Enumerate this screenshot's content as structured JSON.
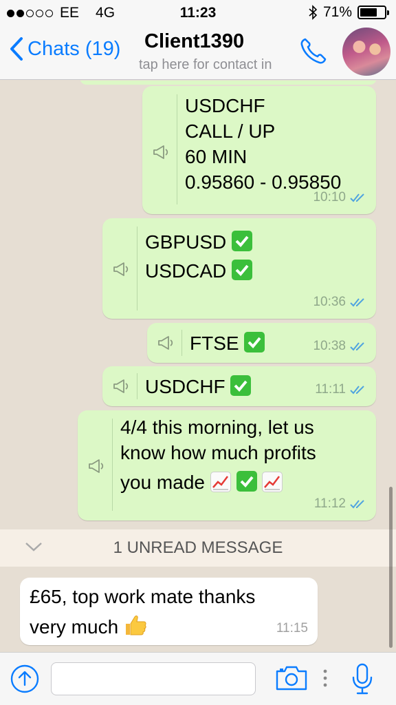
{
  "status_bar": {
    "carrier": "EE",
    "network": "4G",
    "time": "11:23",
    "battery": "71%",
    "battery_level": 0.71
  },
  "nav": {
    "back_label": "Chats (19)",
    "contact_name": "Client1390",
    "contact_subtitle": "tap here for contact in"
  },
  "messages": [
    {
      "lines": [
        "USDCHF",
        "CALL / UP",
        "60 MIN",
        "0.95860 - 0.95850"
      ],
      "time": "10:10",
      "read": true
    },
    {
      "lines": [
        "GBPUSD",
        "",
        "USDCAD"
      ],
      "time": "10:36",
      "read": true
    },
    {
      "lines": [
        "FTSE"
      ],
      "time": "10:38",
      "read": true
    },
    {
      "lines": [
        "USDCHF"
      ],
      "time": "11:11",
      "read": true
    },
    {
      "lines": [
        "4/4 this morning, let us",
        "know how much profits",
        "you made"
      ],
      "time": "11:12",
      "read": true
    }
  ],
  "unread_banner": "1 UNREAD MESSAGE",
  "incoming": {
    "lines": [
      "£65, top work mate thanks",
      "very much"
    ],
    "time": "11:15"
  },
  "input": {
    "placeholder": ""
  },
  "colors": {
    "ios_blue": "#0a7cff",
    "outgoing_bubble": "#dcf8c6",
    "incoming_bubble": "#ffffff",
    "chat_background": "#e6ded3",
    "read_ticks": "#4fa3e0"
  },
  "icons": [
    "back-chevron-icon",
    "phone-icon",
    "megaphone-icon",
    "check-mark-emoji",
    "chart-increasing-emoji",
    "thumbs-up-emoji",
    "double-check-icon",
    "chevron-down-icon",
    "upload-arrow-icon",
    "camera-icon",
    "more-dots-icon",
    "microphone-icon"
  ]
}
